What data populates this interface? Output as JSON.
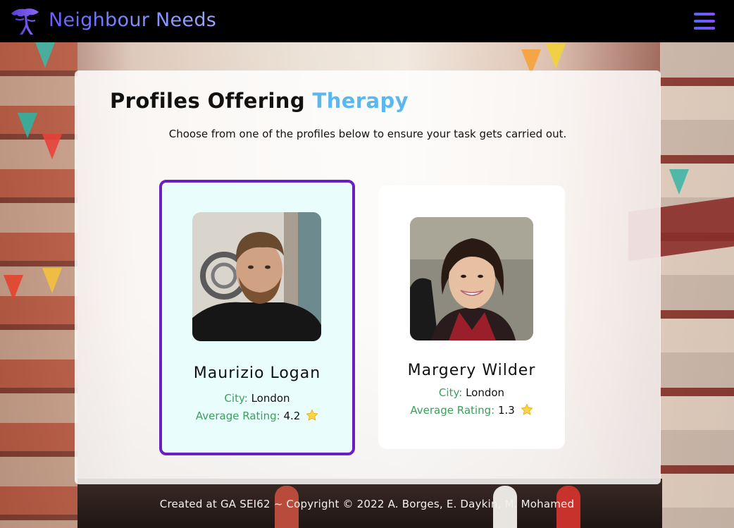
{
  "header": {
    "brand": "Neighbour Needs",
    "logo_icon": "tree-icon",
    "menu_icon": "hamburger-menu-icon",
    "brand_gradient": [
      "#6a5cff",
      "#9aa7ff"
    ]
  },
  "page": {
    "title_prefix": "Profiles Offering",
    "title_service": "Therapy",
    "subtitle": "Choose from one of the profiles below to ensure your task gets carried out."
  },
  "profiles": [
    {
      "name": "Maurizio Logan",
      "city_label": "City:",
      "city": "London",
      "rating_label": "Average Rating:",
      "rating": "4.2",
      "selected": true
    },
    {
      "name": "Margery Wilder",
      "city_label": "City:",
      "city": "London",
      "rating_label": "Average Rating:",
      "rating": "1.3",
      "selected": false
    }
  ],
  "footer": {
    "text": "Created at GA SEI62 ~ Copyright © 2022 A. Borges, E. Daykin, M. Mohamed"
  },
  "colors": {
    "accent": "#5ab8ee",
    "selected_border": "#6a1fc2",
    "label_green": "#3aa05a",
    "header_bg": "#000000"
  }
}
